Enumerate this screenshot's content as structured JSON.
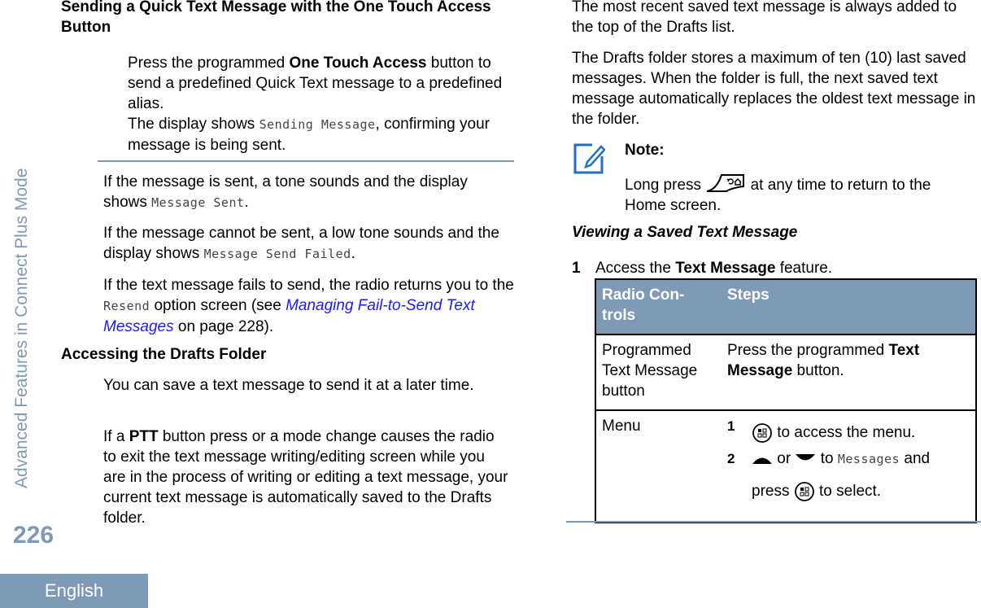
{
  "sidebar": {
    "section_title": "Advanced Features in Connect Plus Mode",
    "page_number": "226",
    "language": "English"
  },
  "left": {
    "heading1": "Sending a Quick Text Message with the One Touch Access Button",
    "step_intro_pre": "Press the programmed ",
    "step_intro_bold": "One Touch Access",
    "step_intro_post": " button to send a predefined Quick Text message to a predefined alias.",
    "display_pre": "The display shows ",
    "display_mono": "Sending Message",
    "display_post": ", confirming your message is being sent.",
    "sent_pre": "If the message is sent, a tone sounds and the display shows ",
    "sent_mono": "Message Sent",
    "sent_post": ".",
    "failed_pre": "If the message cannot be sent, a low tone sounds and the display shows ",
    "failed_mono": "Message Send Failed",
    "failed_post": ".",
    "resend_pre": "If the text message fails to send, the radio returns you to the ",
    "resend_mono": "Resend",
    "resend_mid": " option screen (see ",
    "resend_link": "Managing Fail-to-Send Text Messages",
    "resend_post": " on page 228).",
    "heading2": "Accessing the Drafts Folder",
    "drafts_p1": "You can save a text message to send it at a later time.",
    "drafts_p2_pre": "If a ",
    "drafts_p2_bold": "PTT",
    "drafts_p2_post": " button press or a mode change causes the radio to exit the text message writing/editing screen while you are in the process of writing or editing a text message, your current text message is automatically saved to the Drafts folder."
  },
  "right": {
    "p1": "The most recent saved text message is always added to the top of the Drafts list.",
    "p2": "The Drafts folder stores a maximum of ten (10) last saved messages. When the folder is full, the next saved text message automatically replaces the oldest text message in the folder.",
    "note_label": "Note:",
    "note_pre": "Long press ",
    "note_post": " at any time to return to the Home screen.",
    "heading3": "Viewing a Saved Text Message",
    "step1_num": "1",
    "step1_pre": "Access the ",
    "step1_bold": "Text Message",
    "step1_post": " feature.",
    "table": {
      "headers": [
        "Radio Con-trols",
        "Steps"
      ],
      "row1_control": "Programmed Text Message button",
      "row1_pre": "Press the programmed ",
      "row1_bold": "Text Message",
      "row1_post": " button.",
      "row2_control": "Menu",
      "row2_sub1_num": "1",
      "row2_sub1_text": " to access the menu.",
      "row2_sub2_num": "2",
      "row2_sub2_or": " or ",
      "row2_sub2_to": " to ",
      "row2_sub2_mono": "Messages",
      "row2_sub2_and": " and",
      "row2_sub2_press": "press ",
      "row2_sub2_select": " to select."
    }
  },
  "colors": {
    "accent": "#7f9ab6",
    "link": "#1a1aff",
    "note_icon": "#1f72c0"
  }
}
